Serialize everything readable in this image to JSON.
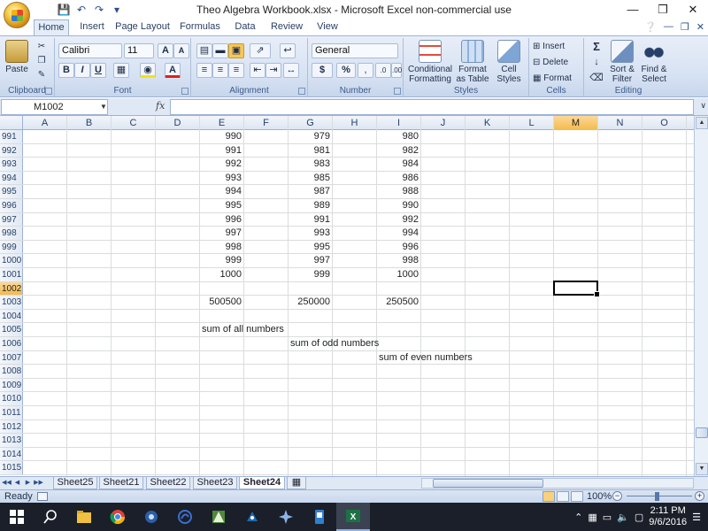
{
  "window": {
    "title": "Theo Algebra Workbook.xlsx - Microsoft Excel non-commercial use"
  },
  "ribbon": {
    "tabs": [
      "Home",
      "Insert",
      "Page Layout",
      "Formulas",
      "Data",
      "Review",
      "View"
    ],
    "active_tab": "Home",
    "clipboard": {
      "paste": "Paste",
      "label": "Clipboard"
    },
    "font": {
      "name": "Calibri",
      "size": "11",
      "label": "Font"
    },
    "alignment": {
      "label": "Alignment"
    },
    "number": {
      "format": "General",
      "label": "Number",
      "currency": "$",
      "percent": "%"
    },
    "styles": {
      "conditional_formatting": "Conditional Formatting",
      "format_as_table": "Format as Table",
      "cell_styles": "Cell Styles",
      "label": "Styles"
    },
    "cells": {
      "insert": "Insert",
      "delete": "Delete",
      "format": "Format",
      "label": "Cells"
    },
    "editing": {
      "sort_filter": "Sort & Filter",
      "find_select": "Find & Select",
      "label": "Editing"
    }
  },
  "formula_bar": {
    "name_box": "M1002",
    "fx": "fx",
    "content": ""
  },
  "grid": {
    "columns": [
      "A",
      "B",
      "C",
      "D",
      "E",
      "F",
      "G",
      "H",
      "I",
      "J",
      "K",
      "L",
      "M",
      "N",
      "O"
    ],
    "selected_column": "M",
    "selected_row": "1002",
    "rows": [
      {
        "n": "991",
        "E": "990",
        "G": "979",
        "I": "980"
      },
      {
        "n": "992",
        "E": "991",
        "G": "981",
        "I": "982"
      },
      {
        "n": "993",
        "E": "992",
        "G": "983",
        "I": "984"
      },
      {
        "n": "994",
        "E": "993",
        "G": "985",
        "I": "986"
      },
      {
        "n": "995",
        "E": "994",
        "G": "987",
        "I": "988"
      },
      {
        "n": "996",
        "E": "995",
        "G": "989",
        "I": "990"
      },
      {
        "n": "997",
        "E": "996",
        "G": "991",
        "I": "992"
      },
      {
        "n": "998",
        "E": "997",
        "G": "993",
        "I": "994"
      },
      {
        "n": "999",
        "E": "998",
        "G": "995",
        "I": "996"
      },
      {
        "n": "1000",
        "E": "999",
        "G": "997",
        "I": "998"
      },
      {
        "n": "1001",
        "E": "1000",
        "G": "999",
        "I": "1000"
      },
      {
        "n": "1002"
      },
      {
        "n": "1003",
        "E": "500500",
        "G": "250000",
        "I": "250500"
      },
      {
        "n": "1004"
      },
      {
        "n": "1005",
        "E_text": "sum of all numbers"
      },
      {
        "n": "1006",
        "G_text": "sum of odd numbers"
      },
      {
        "n": "1007",
        "I_text": "sum of even numbers"
      },
      {
        "n": "1008"
      },
      {
        "n": "1009"
      },
      {
        "n": "1010"
      },
      {
        "n": "1011"
      },
      {
        "n": "1012"
      },
      {
        "n": "1013"
      },
      {
        "n": "1014"
      },
      {
        "n": "1015"
      }
    ]
  },
  "sheet_tabs": [
    "Sheet25",
    "Sheet21",
    "Sheet22",
    "Sheet23",
    "Sheet24"
  ],
  "active_sheet": "Sheet24",
  "status": {
    "ready": "Ready",
    "zoom": "100%"
  },
  "taskbar": {
    "apps": [
      "start-icon",
      "search-icon",
      "file-explorer-icon",
      "chrome-icon",
      "app-icon-1",
      "app-icon-2",
      "app-icon-3",
      "app-icon-4",
      "app-icon-5",
      "app-icon-6",
      "excel-icon"
    ],
    "time": "2:11 PM",
    "date": "9/6/2016"
  },
  "colors": {
    "ribbon_bg": "#d5e1f2",
    "selected_header": "#f5b94a",
    "taskbar": "#1a1f29"
  }
}
